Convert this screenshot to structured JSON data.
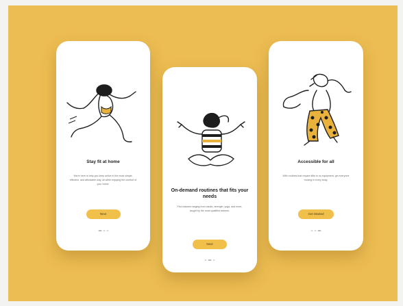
{
  "colors": {
    "background": "#ecbd52",
    "card": "#ffffff",
    "button": "#f1c04b",
    "ink": "#1d1d1d",
    "accent": "#e9b23c"
  },
  "screens": [
    {
      "illustration": "running-person-illustration",
      "title": "Stay fit at home",
      "description": "We're here to help you keep active in the most simple, effective, and affordable way, all while enjoying the comfort of your home.",
      "button_label": "Next"
    },
    {
      "illustration": "meditating-person-illustration",
      "title": "On-demand routines that fits your needs",
      "description": "Find classes ranging from cardio, strength, yoga, and more, taught by the most qualified trainers.",
      "button_label": "Next"
    },
    {
      "illustration": "dancing-person-illustration",
      "title": "Accessible for all",
      "description": "With routines that require little to no equipment, get everyone moving in every body.",
      "button_label": "Get Started"
    }
  ]
}
